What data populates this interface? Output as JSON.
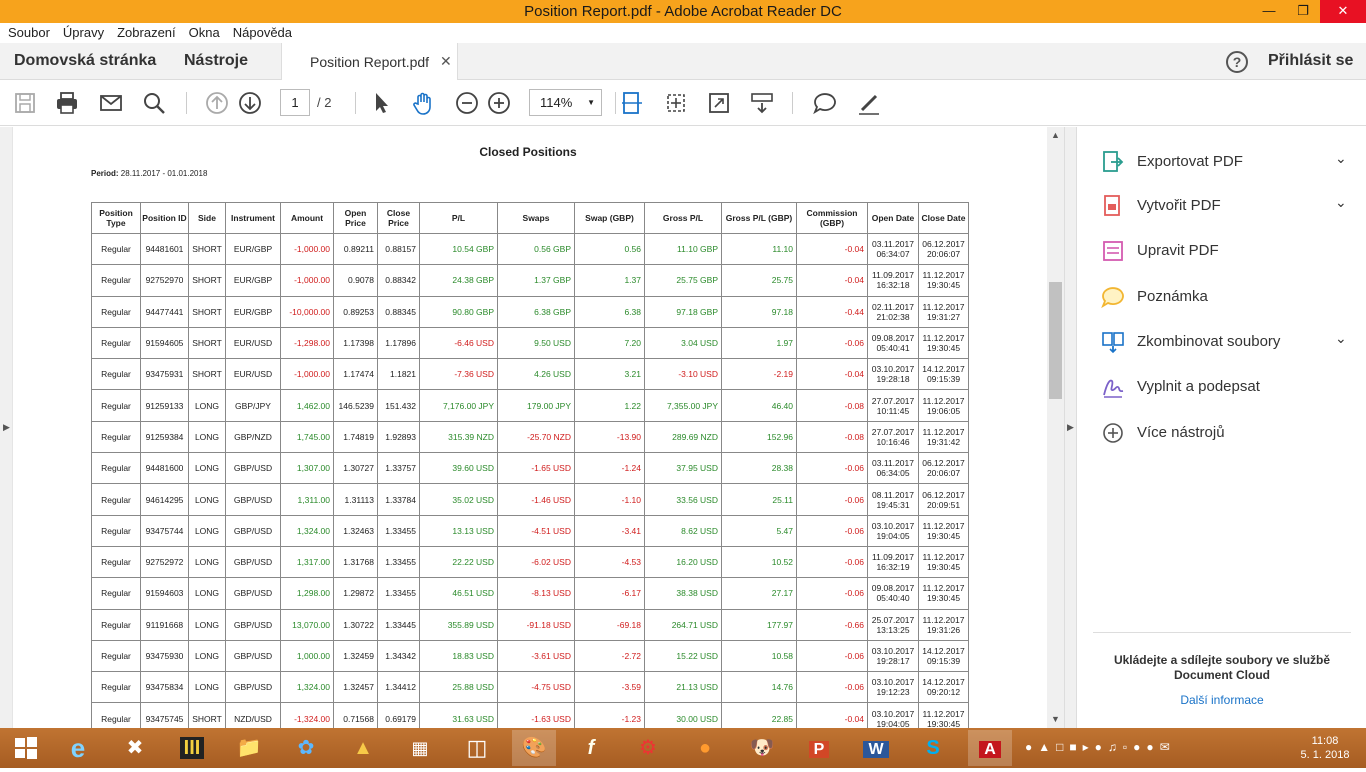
{
  "window": {
    "title": "Position Report.pdf - Adobe Acrobat Reader DC"
  },
  "menu": [
    "Soubor",
    "Úpravy",
    "Zobrazení",
    "Okna",
    "Nápověda"
  ],
  "tabs": {
    "home": "Domovská stránka",
    "tools": "Nástroje",
    "document": "Position Report.pdf",
    "signin": "Přihlásit se",
    "help": "?"
  },
  "toolbar": {
    "page_current": "1",
    "page_total": "/ 2",
    "zoom": "114%"
  },
  "report": {
    "title": "Closed Positions",
    "period_label": "Period:",
    "period_value": "28.11.2017 - 01.01.2018",
    "headers": [
      "Position Type",
      "Position ID",
      "Side",
      "Instrument",
      "Amount",
      "Open Price",
      "Close Price",
      "P/L",
      "Swaps",
      "Swap (GBP)",
      "Gross P/L",
      "Gross P/L (GBP)",
      "Commission (GBP)",
      "Open Date",
      "Close Date"
    ],
    "rows": [
      {
        "type": "Regular",
        "id": "94481601",
        "side": "SHORT",
        "instrument": "EUR/GBP",
        "amount": "-1,000.00",
        "open": "0.89211",
        "close": "0.88157",
        "pl": "10.54 GBP",
        "swaps": "0.56 GBP",
        "swap_gbp": "0.56",
        "gross": "11.10 GBP",
        "gross_gbp": "11.10",
        "comm": "-0.04",
        "od1": "03.11.2017",
        "od2": "06:34:07",
        "cd1": "06.12.2017",
        "cd2": "20:06:07"
      },
      {
        "type": "Regular",
        "id": "92752970",
        "side": "SHORT",
        "instrument": "EUR/GBP",
        "amount": "-1,000.00",
        "open": "0.9078",
        "close": "0.88342",
        "pl": "24.38 GBP",
        "swaps": "1.37 GBP",
        "swap_gbp": "1.37",
        "gross": "25.75 GBP",
        "gross_gbp": "25.75",
        "comm": "-0.04",
        "od1": "11.09.2017",
        "od2": "16:32:18",
        "cd1": "11.12.2017",
        "cd2": "19:30:45"
      },
      {
        "type": "Regular",
        "id": "94477441",
        "side": "SHORT",
        "instrument": "EUR/GBP",
        "amount": "-10,000.00",
        "open": "0.89253",
        "close": "0.88345",
        "pl": "90.80 GBP",
        "swaps": "6.38 GBP",
        "swap_gbp": "6.38",
        "gross": "97.18 GBP",
        "gross_gbp": "97.18",
        "comm": "-0.44",
        "od1": "02.11.2017",
        "od2": "21:02:38",
        "cd1": "11.12.2017",
        "cd2": "19:31:27"
      },
      {
        "type": "Regular",
        "id": "91594605",
        "side": "SHORT",
        "instrument": "EUR/USD",
        "amount": "-1,298.00",
        "open": "1.17398",
        "close": "1.17896",
        "pl": "-6.46 USD",
        "swaps": "9.50 USD",
        "swap_gbp": "7.20",
        "gross": "3.04 USD",
        "gross_gbp": "1.97",
        "comm": "-0.06",
        "od1": "09.08.2017",
        "od2": "05:40:41",
        "cd1": "11.12.2017",
        "cd2": "19:30:45"
      },
      {
        "type": "Regular",
        "id": "93475931",
        "side": "SHORT",
        "instrument": "EUR/USD",
        "amount": "-1,000.00",
        "open": "1.17474",
        "close": "1.1821",
        "pl": "-7.36 USD",
        "swaps": "4.26 USD",
        "swap_gbp": "3.21",
        "gross": "-3.10 USD",
        "gross_gbp": "-2.19",
        "comm": "-0.04",
        "od1": "03.10.2017",
        "od2": "19:28:18",
        "cd1": "14.12.2017",
        "cd2": "09:15:39"
      },
      {
        "type": "Regular",
        "id": "91259133",
        "side": "LONG",
        "instrument": "GBP/JPY",
        "amount": "1,462.00",
        "open": "146.5239",
        "close": "151.432",
        "pl": "7,176.00 JPY",
        "swaps": "179.00 JPY",
        "swap_gbp": "1.22",
        "gross": "7,355.00 JPY",
        "gross_gbp": "46.40",
        "comm": "-0.08",
        "od1": "27.07.2017",
        "od2": "10:11:45",
        "cd1": "11.12.2017",
        "cd2": "19:06:05"
      },
      {
        "type": "Regular",
        "id": "91259384",
        "side": "LONG",
        "instrument": "GBP/NZD",
        "amount": "1,745.00",
        "open": "1.74819",
        "close": "1.92893",
        "pl": "315.39 NZD",
        "swaps": "-25.70 NZD",
        "swap_gbp": "-13.90",
        "gross": "289.69 NZD",
        "gross_gbp": "152.96",
        "comm": "-0.08",
        "od1": "27.07.2017",
        "od2": "10:16:46",
        "cd1": "11.12.2017",
        "cd2": "19:31:42"
      },
      {
        "type": "Regular",
        "id": "94481600",
        "side": "LONG",
        "instrument": "GBP/USD",
        "amount": "1,307.00",
        "open": "1.30727",
        "close": "1.33757",
        "pl": "39.60 USD",
        "swaps": "-1.65 USD",
        "swap_gbp": "-1.24",
        "gross": "37.95 USD",
        "gross_gbp": "28.38",
        "comm": "-0.06",
        "od1": "03.11.2017",
        "od2": "06:34:05",
        "cd1": "06.12.2017",
        "cd2": "20:06:07"
      },
      {
        "type": "Regular",
        "id": "94614295",
        "side": "LONG",
        "instrument": "GBP/USD",
        "amount": "1,311.00",
        "open": "1.31113",
        "close": "1.33784",
        "pl": "35.02 USD",
        "swaps": "-1.46 USD",
        "swap_gbp": "-1.10",
        "gross": "33.56 USD",
        "gross_gbp": "25.11",
        "comm": "-0.06",
        "od1": "08.11.2017",
        "od2": "19:45:31",
        "cd1": "06.12.2017",
        "cd2": "20:09:51"
      },
      {
        "type": "Regular",
        "id": "93475744",
        "side": "LONG",
        "instrument": "GBP/USD",
        "amount": "1,324.00",
        "open": "1.32463",
        "close": "1.33455",
        "pl": "13.13 USD",
        "swaps": "-4.51 USD",
        "swap_gbp": "-3.41",
        "gross": "8.62 USD",
        "gross_gbp": "5.47",
        "comm": "-0.06",
        "od1": "03.10.2017",
        "od2": "19:04:05",
        "cd1": "11.12.2017",
        "cd2": "19:30:45"
      },
      {
        "type": "Regular",
        "id": "92752972",
        "side": "LONG",
        "instrument": "GBP/USD",
        "amount": "1,317.00",
        "open": "1.31768",
        "close": "1.33455",
        "pl": "22.22 USD",
        "swaps": "-6.02 USD",
        "swap_gbp": "-4.53",
        "gross": "16.20 USD",
        "gross_gbp": "10.52",
        "comm": "-0.06",
        "od1": "11.09.2017",
        "od2": "16:32:19",
        "cd1": "11.12.2017",
        "cd2": "19:30:45"
      },
      {
        "type": "Regular",
        "id": "91594603",
        "side": "LONG",
        "instrument": "GBP/USD",
        "amount": "1,298.00",
        "open": "1.29872",
        "close": "1.33455",
        "pl": "46.51 USD",
        "swaps": "-8.13 USD",
        "swap_gbp": "-6.17",
        "gross": "38.38 USD",
        "gross_gbp": "27.17",
        "comm": "-0.06",
        "od1": "09.08.2017",
        "od2": "05:40:40",
        "cd1": "11.12.2017",
        "cd2": "19:30:45"
      },
      {
        "type": "Regular",
        "id": "91191668",
        "side": "LONG",
        "instrument": "GBP/USD",
        "amount": "13,070.00",
        "open": "1.30722",
        "close": "1.33445",
        "pl": "355.89 USD",
        "swaps": "-91.18 USD",
        "swap_gbp": "-69.18",
        "gross": "264.71 USD",
        "gross_gbp": "177.97",
        "comm": "-0.66",
        "od1": "25.07.2017",
        "od2": "13:13:25",
        "cd1": "11.12.2017",
        "cd2": "19:31:26"
      },
      {
        "type": "Regular",
        "id": "93475930",
        "side": "LONG",
        "instrument": "GBP/USD",
        "amount": "1,000.00",
        "open": "1.32459",
        "close": "1.34342",
        "pl": "18.83 USD",
        "swaps": "-3.61 USD",
        "swap_gbp": "-2.72",
        "gross": "15.22 USD",
        "gross_gbp": "10.58",
        "comm": "-0.06",
        "od1": "03.10.2017",
        "od2": "19:28:17",
        "cd1": "14.12.2017",
        "cd2": "09:15:39"
      },
      {
        "type": "Regular",
        "id": "93475834",
        "side": "LONG",
        "instrument": "GBP/USD",
        "amount": "1,324.00",
        "open": "1.32457",
        "close": "1.34412",
        "pl": "25.88 USD",
        "swaps": "-4.75 USD",
        "swap_gbp": "-3.59",
        "gross": "21.13 USD",
        "gross_gbp": "14.76",
        "comm": "-0.06",
        "od1": "03.10.2017",
        "od2": "19:12:23",
        "cd1": "14.12.2017",
        "cd2": "09:20:12"
      },
      {
        "type": "Regular",
        "id": "93475745",
        "side": "SHORT",
        "instrument": "NZD/USD",
        "amount": "-1,324.00",
        "open": "0.71568",
        "close": "0.69179",
        "pl": "31.63 USD",
        "swaps": "-1.63 USD",
        "swap_gbp": "-1.23",
        "gross": "30.00 USD",
        "gross_gbp": "22.85",
        "comm": "-0.04",
        "od1": "03.10.2017",
        "od2": "19:04:05",
        "cd1": "11.12.2017",
        "cd2": "19:30:45"
      }
    ]
  },
  "tools_panel": {
    "items": [
      {
        "label": "Exportovat PDF",
        "icon": "export-pdf-icon",
        "chevron": true
      },
      {
        "label": "Vytvořit PDF",
        "icon": "create-pdf-icon",
        "chevron": true
      },
      {
        "label": "Upravit PDF",
        "icon": "edit-pdf-icon",
        "chevron": false
      },
      {
        "label": "Poznámka",
        "icon": "comment-icon",
        "chevron": false
      },
      {
        "label": "Zkombinovat soubory",
        "icon": "combine-icon",
        "chevron": true
      },
      {
        "label": "Vyplnit a podepsat",
        "icon": "sign-icon",
        "chevron": false
      },
      {
        "label": "Více nástrojů",
        "icon": "plus-circle-icon",
        "chevron": false
      }
    ],
    "promo": "Ukládejte a sdílejte soubory ve službě Document Cloud",
    "more_link": "Další informace"
  },
  "taskbar": {
    "time": "11:08",
    "date": "5. 1. 2018"
  },
  "colors": {
    "titlebar": "#f7a31c",
    "accent": "#1a73c8",
    "positive": "#2a8a2a",
    "negative": "#d01c1c",
    "taskbar": "#b36a2f"
  }
}
